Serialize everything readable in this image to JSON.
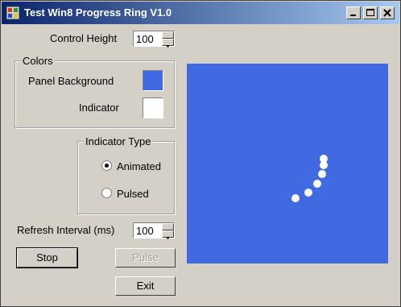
{
  "window": {
    "title": "Test Win8 Progress Ring V1.0"
  },
  "control_height": {
    "label": "Control Height",
    "value": "100"
  },
  "colors_group": {
    "label": "Colors",
    "panel_background_label": "Panel Background",
    "panel_background_color": "#4169e1",
    "indicator_label": "Indicator",
    "indicator_color": "#ffffff"
  },
  "indicator_type": {
    "label": "Indicator Type",
    "options": [
      {
        "label": "Animated",
        "selected": true
      },
      {
        "label": "Pulsed",
        "selected": false
      }
    ]
  },
  "refresh_interval": {
    "label": "Refresh Interval (ms)",
    "value": "100"
  },
  "buttons": {
    "stop": "Stop",
    "pulse": "Pulse",
    "exit": "Exit"
  }
}
